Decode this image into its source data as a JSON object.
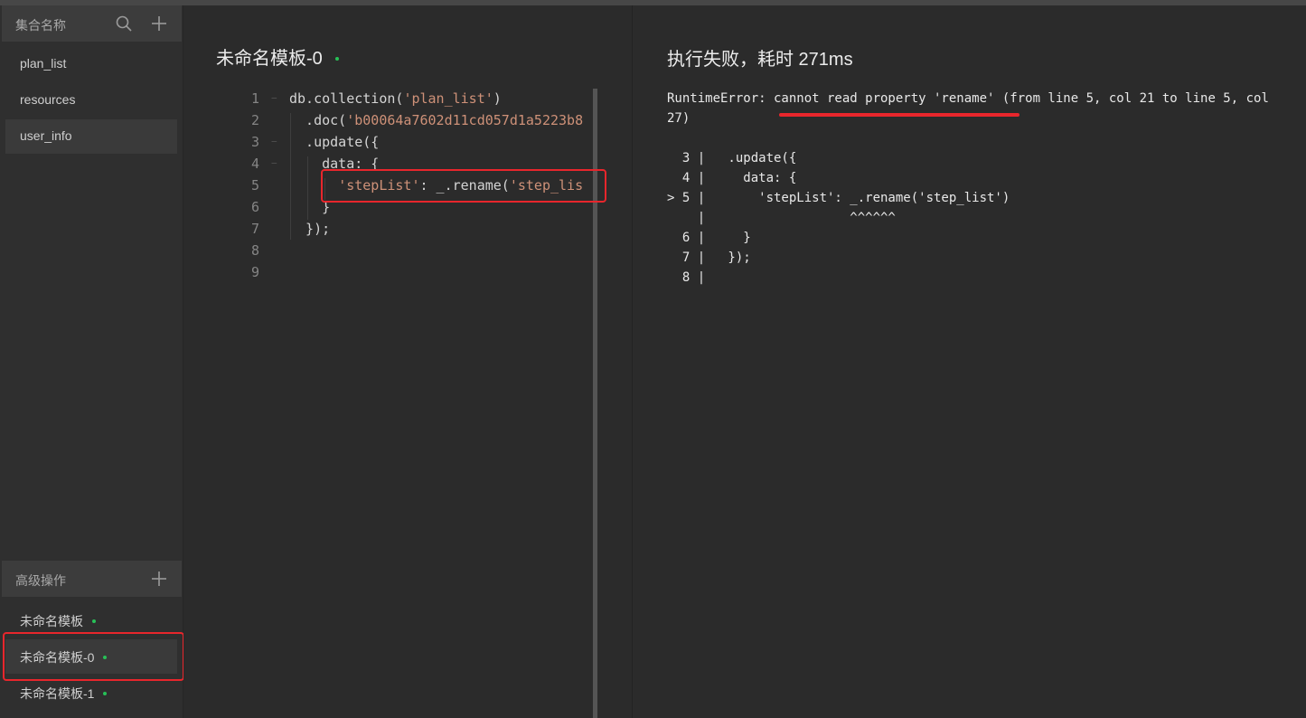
{
  "sidebar": {
    "collections_header": "集合名称",
    "collections": [
      "plan_list",
      "resources",
      "user_info"
    ],
    "advanced_header": "高级操作",
    "templates": [
      "未命名模板",
      "未命名模板-0",
      "未命名模板-1"
    ]
  },
  "editor": {
    "title": "未命名模板-0",
    "lines": [
      {
        "n": "1",
        "parts": [
          {
            "t": "db.collection("
          },
          {
            "t": "'plan_list'",
            "s": 1
          },
          {
            "t": ")"
          }
        ]
      },
      {
        "n": "2",
        "parts": [
          {
            "t": "  .doc("
          },
          {
            "t": "'b00064a7602d11cd057d1a5223b8",
            "s": 1
          }
        ]
      },
      {
        "n": "3",
        "parts": [
          {
            "t": "  .update({"
          }
        ]
      },
      {
        "n": "4",
        "parts": [
          {
            "t": "    data: {"
          }
        ]
      },
      {
        "n": "5",
        "parts": [
          {
            "t": "      "
          },
          {
            "t": "'stepList'",
            "s": 1
          },
          {
            "t": ": _.rename("
          },
          {
            "t": "'step_lis",
            "s": 1
          }
        ]
      },
      {
        "n": "6",
        "parts": [
          {
            "t": "    }"
          }
        ]
      },
      {
        "n": "7",
        "parts": [
          {
            "t": "  });"
          }
        ]
      },
      {
        "n": "8",
        "parts": []
      },
      {
        "n": "9",
        "parts": []
      }
    ]
  },
  "result": {
    "title": "执行失败，耗时 271ms",
    "error_message": "RuntimeError: cannot read property 'rename' (from line 5, col 21 to line 5, col 27)",
    "snippet": [
      "  3 |   .update({",
      "  4 |     data: {",
      "> 5 |       'stepList': _.rename('step_list')",
      "    |                   ^^^^^^",
      "  6 |     }",
      "  7 |   });",
      "  8 |"
    ]
  },
  "colors": {
    "accent_green": "#27c157",
    "annotation_red": "#e8262c",
    "string": "#ce9178"
  },
  "icons": [
    "search-icon",
    "plus-icon"
  ]
}
